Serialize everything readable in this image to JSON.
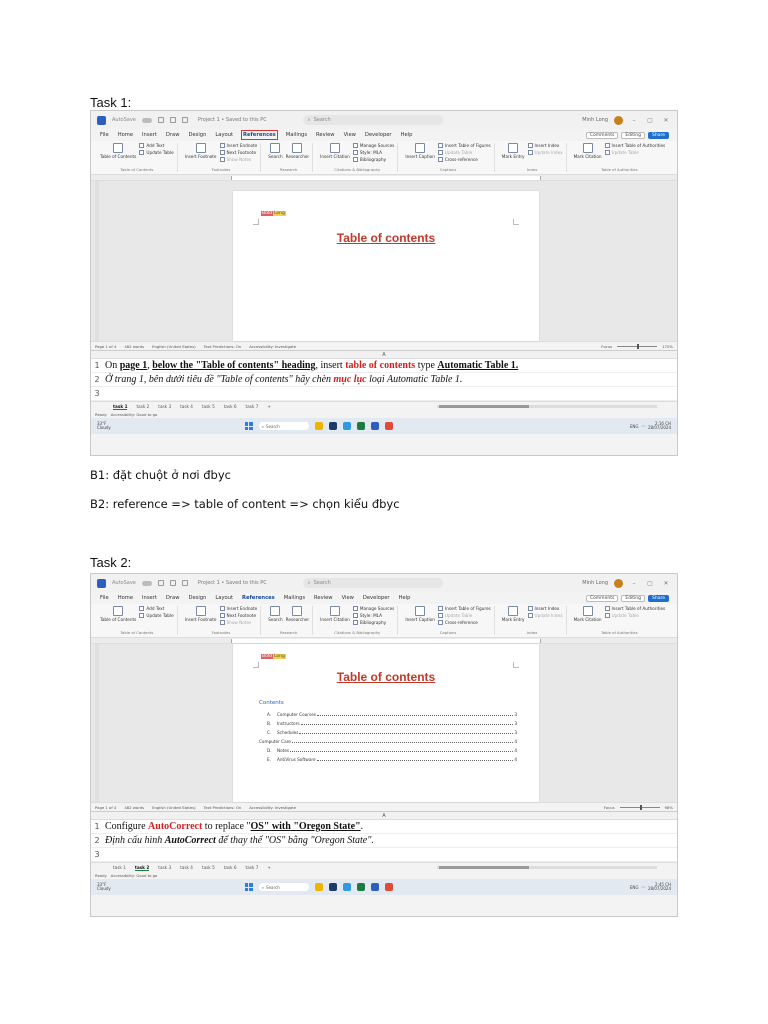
{
  "doc": {
    "task1_heading": "Task 1:",
    "task2_heading": "Task 2:",
    "step1": "B1: đặt chuột ở nơi đbyc",
    "step2": "B2: reference => table of content => chọn kiểu đbyc"
  },
  "window": {
    "autosave": "AutoSave",
    "doc_title": "Project 1 • Saved to this PC",
    "search": "Search",
    "user": "Minh Long",
    "minimize": "–",
    "restore": "▢",
    "close": "✕"
  },
  "menu": {
    "tabs": [
      "File",
      "Home",
      "Insert",
      "Draw",
      "Design",
      "Layout",
      "References",
      "Mailings",
      "Review",
      "View",
      "Developer",
      "Help"
    ],
    "comments": "Comments",
    "editing": "Editing",
    "share": "Share"
  },
  "ribbon": {
    "toc": {
      "add_text": "Add Text",
      "update_table": "Update Table",
      "toc_button": "Table of Contents",
      "group": "Table of Contents"
    },
    "footnotes": {
      "insert_footnote": "Insert Footnote",
      "insert_endnote": "Insert Endnote",
      "next_footnote": "Next Footnote",
      "show_notes": "Show Notes",
      "group": "Footnotes"
    },
    "research": {
      "search": "Search",
      "researcher": "Researcher",
      "group": "Research"
    },
    "citations": {
      "insert_citation": "Insert Citation",
      "manage_sources": "Manage Sources",
      "style": "Style: MLA",
      "bibliography": "Bibliography",
      "group": "Citations & Bibliography"
    },
    "captions": {
      "insert_caption": "Insert Caption",
      "insert_tof": "Insert Table of Figures",
      "update_table": "Update Table",
      "cross_reference": "Cross-reference",
      "group": "Captions"
    },
    "index": {
      "mark_entry": "Mark Entry",
      "insert_index": "Insert Index",
      "update_index": "Update Index",
      "group": "Index"
    },
    "authorities": {
      "mark_citation": "Mark Citation",
      "insert_toa": "Insert Table of Authorities",
      "update_table": "Update Table",
      "group": "Table of Authorities"
    }
  },
  "page": {
    "tag_a": "Bold",
    "tag_b": "Long",
    "heading": "Table of contents"
  },
  "toc": {
    "title": "Contents",
    "rows": [
      {
        "num": "A.",
        "label": "Computer Courses",
        "page": "3",
        "indent": true
      },
      {
        "num": "B.",
        "label": "Instructors",
        "page": "3",
        "indent": true
      },
      {
        "num": "C.",
        "label": "Schedules",
        "page": "3",
        "indent": true
      },
      {
        "num": "",
        "label": "Computer Care",
        "page": "4",
        "indent": false
      },
      {
        "num": "D.",
        "label": "Notes",
        "page": "4",
        "indent": true
      },
      {
        "num": "E.",
        "label": "AntiVirus Software",
        "page": "4",
        "indent": true
      }
    ]
  },
  "status1": {
    "page": "Page 1 of 4",
    "words": "482 words",
    "lang": "English (United States)",
    "predict": "Text Predictions: On",
    "access": "Accessibility: Investigate",
    "focus": "Focus",
    "zoom": "170%"
  },
  "status2": {
    "page": "Page 1 of 4",
    "words": "482 words",
    "lang": "English (United States)",
    "predict": "Text Predictions: On",
    "access": "Accessibility: Investigate",
    "focus": "Focus",
    "zoom": "98%"
  },
  "excel1": {
    "col": "A",
    "rows": [
      "1",
      "2",
      "3"
    ],
    "r1": {
      "a": "On ",
      "b": "page 1",
      "c": ", ",
      "d": "below the \"Table of contents\" heading",
      "e": ", insert ",
      "f": "table of contents",
      "g": " type ",
      "h": "Automatic Table 1."
    },
    "r2": {
      "a": "Ở trang 1, bên dưới tiêu đề \"Table of contents\" hãy chèn ",
      "b": "mục lục",
      "c": " loại Automatic Table 1."
    },
    "sheets": [
      "task 1",
      "task 2",
      "task 3",
      "task 4",
      "task 5",
      "task 6",
      "task 7"
    ],
    "add_sheet": "+",
    "ready": "Ready",
    "access": "Accessibility: Good to go"
  },
  "excel2": {
    "col": "A",
    "rows": [
      "1",
      "2",
      "3"
    ],
    "r1": {
      "a": "Configure ",
      "b": "AutoCorrect",
      "c": " to replace \"",
      "d": "OS\" with \"Oregon State\"",
      "e": "."
    },
    "r2": {
      "a": "Định cấu hình ",
      "b": "AutoCorrect",
      "c": " để thay thế \"OS\" bằng \"Oregon State\"."
    },
    "sheets": [
      "task 1",
      "task 2",
      "task 3",
      "task 4",
      "task 5",
      "task 6",
      "task 7"
    ],
    "add_sheet": "+",
    "ready": "Ready",
    "access": "Accessibility: Good to go"
  },
  "taskbar1": {
    "temp": "33°F",
    "cond": "Cloudy",
    "search": "Search",
    "lang": "ENG",
    "time": "2:16 CH",
    "date": "28/07/2024"
  },
  "taskbar2": {
    "temp": "33°F",
    "cond": "Cloudy",
    "search": "Search",
    "lang": "ENG",
    "time": "2:45 CH",
    "date": "28/07/2024"
  },
  "colors": {
    "accent": "#2b5ebf",
    "heading_red": "#c0392b",
    "task_red": "#d21f1f",
    "excel_green": "#1c7c3f"
  }
}
